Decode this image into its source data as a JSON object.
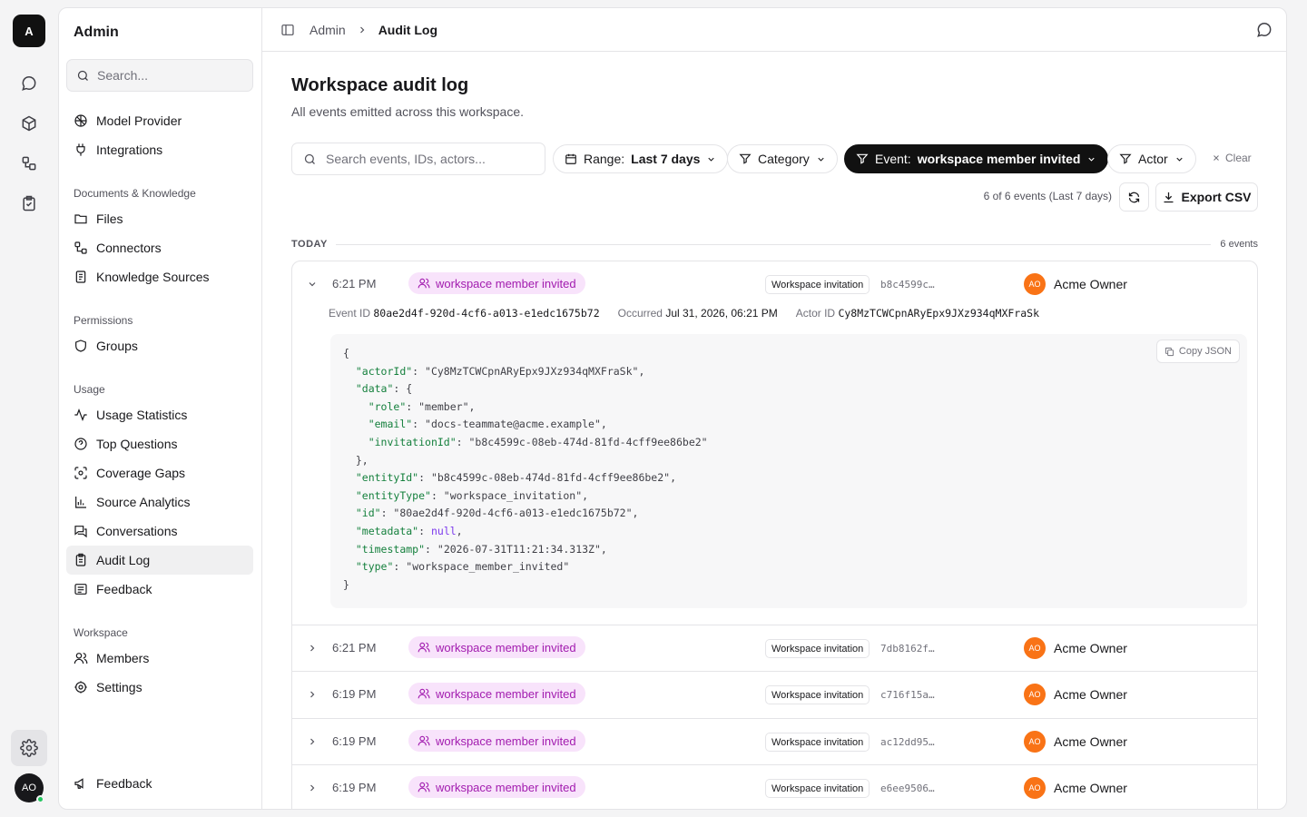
{
  "rail": {
    "logo": "A",
    "avatar": "AO"
  },
  "sidebar": {
    "title": "Admin",
    "search_placeholder": "Search...",
    "items_top": [
      {
        "label": "Model Provider"
      },
      {
        "label": "Integrations"
      }
    ],
    "sections": [
      {
        "title": "Documents & Knowledge",
        "items": [
          "Files",
          "Connectors",
          "Knowledge Sources"
        ]
      },
      {
        "title": "Permissions",
        "items": [
          "Groups"
        ]
      },
      {
        "title": "Usage",
        "items": [
          "Usage Statistics",
          "Top Questions",
          "Coverage Gaps",
          "Source Analytics",
          "Conversations",
          "Audit Log",
          "Feedback"
        ]
      },
      {
        "title": "Workspace",
        "items": [
          "Members",
          "Settings"
        ]
      }
    ],
    "footer_feedback": "Feedback",
    "active_item": "Audit Log"
  },
  "breadcrumb": {
    "parent": "Admin",
    "current": "Audit Log"
  },
  "page": {
    "title": "Workspace audit log",
    "subtitle": "All events emitted across this workspace."
  },
  "filters": {
    "search_placeholder": "Search events, IDs, actors...",
    "range_label": "Range:",
    "range_value": "Last 7 days",
    "category_label": "Category",
    "event_label": "Event:",
    "event_value": "workspace member invited",
    "actor_label": "Actor",
    "clear_label": "Clear"
  },
  "summary": {
    "count_text": "6 of 6 events (Last 7 days)",
    "export_label": "Export CSV"
  },
  "group": {
    "label": "TODAY",
    "count": "6 events"
  },
  "expanded": {
    "time": "6:21 PM",
    "badge": "workspace member invited",
    "entity_chip": "Workspace invitation",
    "entity_id": "b8c4599c…",
    "actor": "Acme Owner",
    "actor_initials": "AO",
    "event_id_label": "Event ID",
    "event_id": "80ae2d4f-920d-4cf6-a013-e1edc1675b72",
    "occurred_label": "Occurred",
    "occurred": "Jul 31, 2026, 06:21 PM",
    "actor_id_label": "Actor ID",
    "actor_id": "Cy8MzTCWCpnARyEpx9JXz934qMXFraSk",
    "copy_label": "Copy JSON",
    "json": {
      "actorId": "Cy8MzTCWCpnARyEpx9JXz934qMXFraSk",
      "role": "member",
      "email": "docs-teammate@acme.example",
      "invitationId": "b8c4599c-08eb-474d-81fd-4cff9ee86be2",
      "entityId": "b8c4599c-08eb-474d-81fd-4cff9ee86be2",
      "entityType": "workspace_invitation",
      "id": "80ae2d4f-920d-4cf6-a013-e1edc1675b72",
      "metadata": "null",
      "timestamp": "2026-07-31T11:21:34.313Z",
      "type": "workspace_member_invited"
    }
  },
  "rows": [
    {
      "time": "6:21 PM",
      "badge": "workspace member invited",
      "chip": "Workspace invitation",
      "eid": "7db8162f…",
      "actor": "Acme Owner",
      "initials": "AO"
    },
    {
      "time": "6:19 PM",
      "badge": "workspace member invited",
      "chip": "Workspace invitation",
      "eid": "c716f15a…",
      "actor": "Acme Owner",
      "initials": "AO"
    },
    {
      "time": "6:19 PM",
      "badge": "workspace member invited",
      "chip": "Workspace invitation",
      "eid": "ac12dd95…",
      "actor": "Acme Owner",
      "initials": "AO"
    },
    {
      "time": "6:19 PM",
      "badge": "workspace member invited",
      "chip": "Workspace invitation",
      "eid": "e6ee9506…",
      "actor": "Acme Owner",
      "initials": "AO"
    }
  ],
  "colors": {
    "badge_bg": "#f8e3fb",
    "badge_text": "#a21caf",
    "avatar": "#f97316",
    "active_pill": "#111111"
  }
}
